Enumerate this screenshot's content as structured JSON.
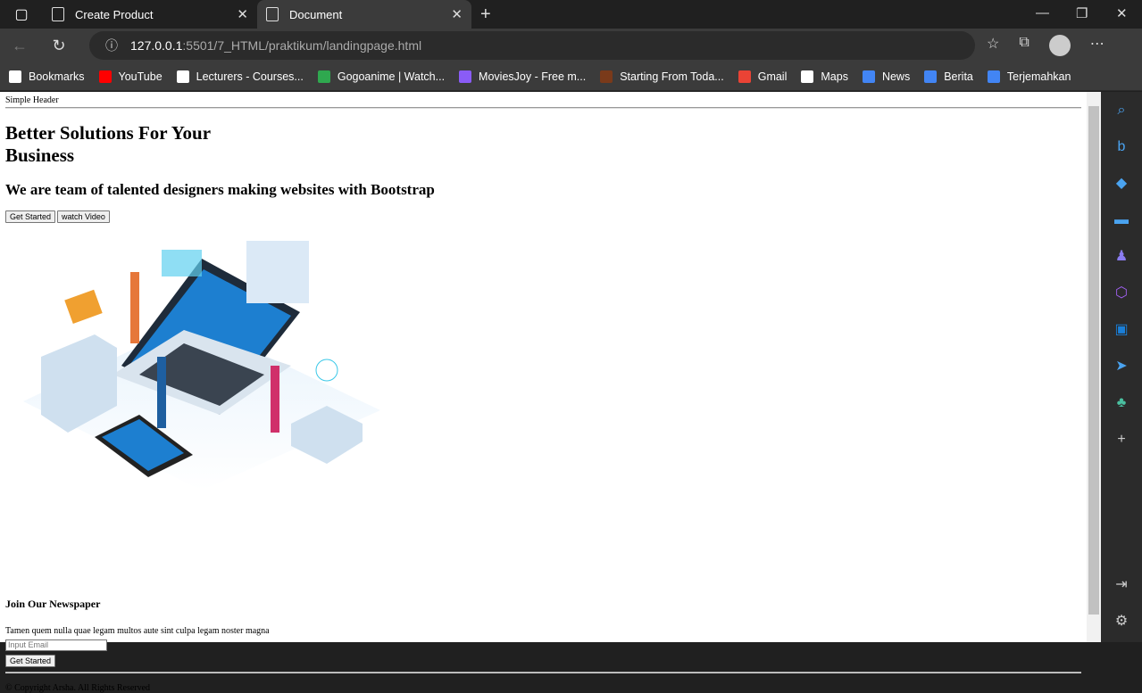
{
  "browser": {
    "tabs": [
      {
        "title": "Create Product",
        "active": false
      },
      {
        "title": "Document",
        "active": true
      }
    ],
    "url_host": "127.0.0.1",
    "url_path": ":5501/7_HTML/praktikum/landingpage.html",
    "bookmarks": [
      {
        "label": "Bookmarks",
        "color": "#ffffff"
      },
      {
        "label": "YouTube",
        "color": "#ff0000"
      },
      {
        "label": "Lecturers - Courses...",
        "color": "#ffffff"
      },
      {
        "label": "Gogoanime | Watch...",
        "color": "#2fa84f"
      },
      {
        "label": "MoviesJoy - Free m...",
        "color": "#8a5cf6"
      },
      {
        "label": "Starting From Toda...",
        "color": "#7a3a1a"
      },
      {
        "label": "Gmail",
        "color": "#ea4335"
      },
      {
        "label": "Maps",
        "color": "#ffffff"
      },
      {
        "label": "News",
        "color": "#4285f4"
      },
      {
        "label": "Berita",
        "color": "#4285f4"
      },
      {
        "label": "Terjemahkan",
        "color": "#4285f4"
      }
    ]
  },
  "page": {
    "header": "Simple Header",
    "title": "Better Solutions For Your Business",
    "subtitle": "We are team of talented designers making websites with Bootstrap",
    "get_started": "Get Started",
    "watch_video": "watch Video",
    "newsletter_title": "Join Our Newspaper",
    "newsletter_text": "Tamen quem nulla quae legam multos aute sint culpa legam noster magna",
    "email_placeholder": "Input Email",
    "subscribe": "Get Started",
    "footer": "© Copyright Arsha. All Rights Reserved"
  }
}
